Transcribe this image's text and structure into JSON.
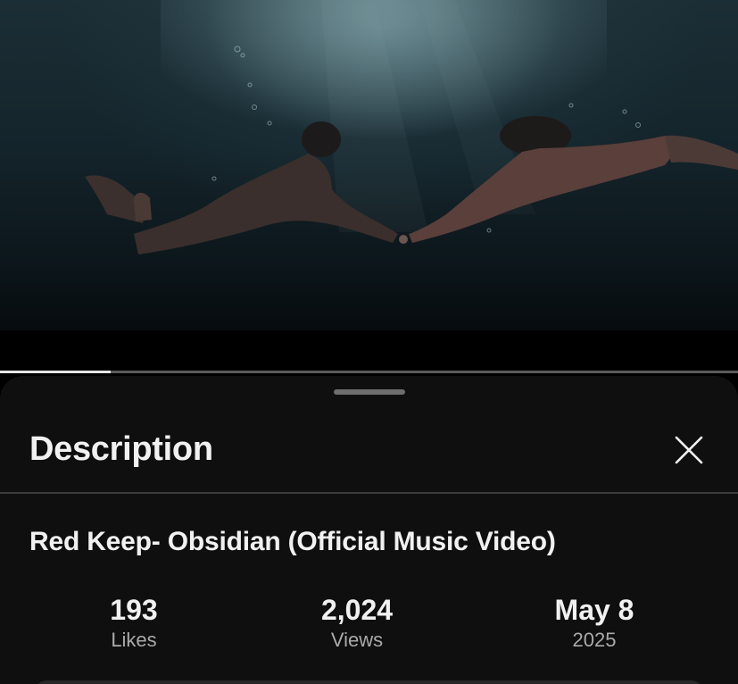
{
  "video": {
    "scene": "underwater-music-video-frame",
    "progress_fraction": 0.15
  },
  "sheet": {
    "title": "Description",
    "close_icon": "close-icon"
  },
  "video_title": "Red Keep- Obsidian (Official Music Video)",
  "stats": [
    {
      "value": "193",
      "label": "Likes"
    },
    {
      "value": "2,024",
      "label": "Views"
    },
    {
      "value": "May 8",
      "label": "2025"
    }
  ],
  "colors": {
    "sheet_background": "#0f0f0f",
    "primary_text": "#f1f1f1",
    "secondary_text": "#aaaaaa",
    "progress_played": "#e6e6e6",
    "progress_remaining": "#5a5a5a"
  }
}
